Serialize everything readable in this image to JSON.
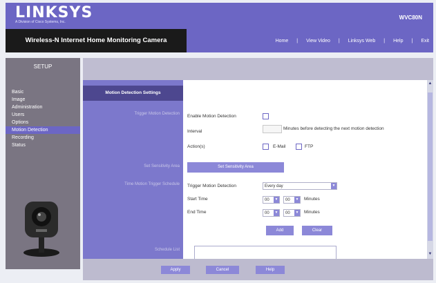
{
  "header": {
    "logo_text": "LINKSYS",
    "logo_sub": "A Division of Cisco Systems, Inc.",
    "model": "WVC80N",
    "product_name": "Wireless-N Internet Home Monitoring Camera"
  },
  "nav": {
    "links": [
      "Home",
      "View Video",
      "Linksys Web",
      "Help",
      "Exit"
    ]
  },
  "sidebar": {
    "setup_label": "SETUP",
    "items": [
      "Basic",
      "Image",
      "Administration",
      "Users",
      "Options",
      "Motion Detection",
      "Recording",
      "Status"
    ],
    "active_index": 5
  },
  "section": {
    "title": "Motion Detection Settings",
    "labels": {
      "trigger": "Trigger Motion Detection",
      "sensitivity": "Set Sensitivity Area",
      "schedule": "Time Motion Trigger Schedule",
      "list": "Schedule List"
    }
  },
  "form": {
    "enable_label": "Enable Motion Detection",
    "enable_checked": false,
    "interval_label": "Interval",
    "interval_value": "",
    "interval_suffix": "Minutes before detecting the next motion detection",
    "actions_label": "Action(s)",
    "email_label": "E-Mail",
    "ftp_label": "FTP",
    "sensitivity_button": "Set Sensitivity Area",
    "trigger_label": "Trigger Motion Detection",
    "trigger_value": "Every day",
    "start_label": "Start Time",
    "start_hour": "00",
    "start_min": "00",
    "end_label": "End Time",
    "end_hour": "00",
    "end_min": "00",
    "minutes_label": "Minutes",
    "add_button": "Add",
    "clear_button": "Clear"
  },
  "footer": {
    "apply": "Apply",
    "cancel": "Cancel",
    "help": "Help"
  }
}
